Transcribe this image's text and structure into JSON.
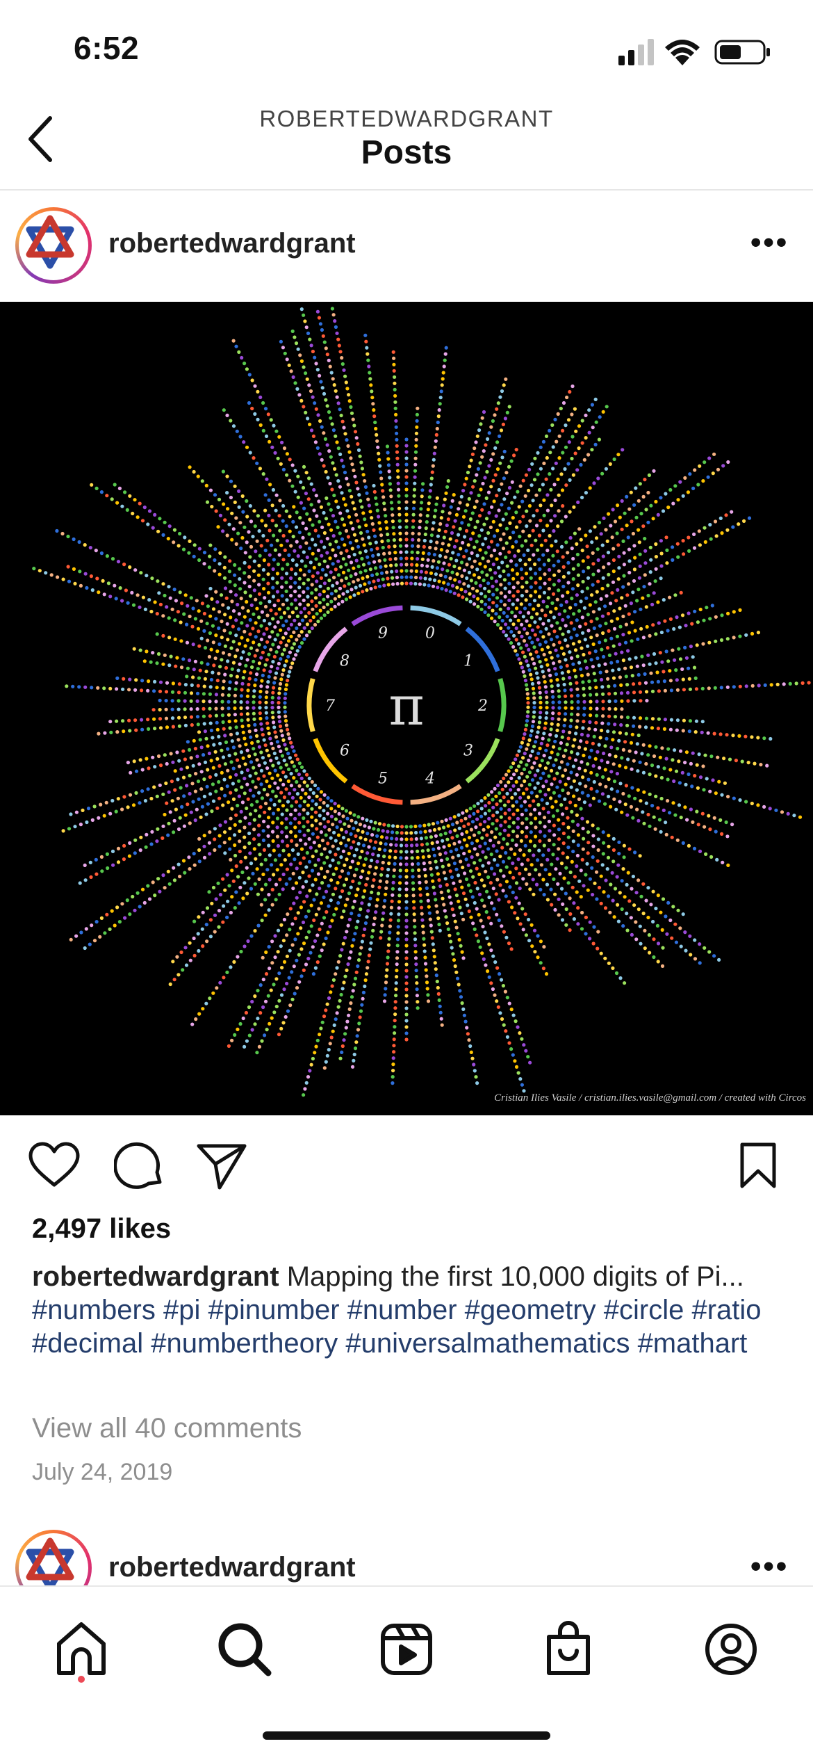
{
  "status_bar": {
    "time": "6:52"
  },
  "header": {
    "username": "ROBERTEDWARDGRANT",
    "title": "Posts"
  },
  "post": {
    "username": "robertedwardgrant",
    "image": {
      "center_symbol": "π",
      "ring_labels": [
        "0",
        "1",
        "2",
        "3",
        "4",
        "5",
        "6",
        "7",
        "8",
        "9"
      ],
      "credit": "Cristian Ilies Vasile / cristian.ilies.vasile@gmail.com / created with Circos"
    },
    "likes": "2,497 likes",
    "caption": {
      "user": "robertedwardgrant",
      "text": "Mapping the first 10,000 digits of Pi...",
      "hashtags": [
        "#numbers",
        "#pi",
        "#pinumber",
        "#number",
        "#geometry",
        "#circle",
        "#ratio",
        "#decimal",
        "#numbertheory",
        "#universalmathematics",
        "#mathart"
      ]
    },
    "view_comments": "View all 40 comments",
    "date": "July 24, 2019"
  },
  "next_post": {
    "username": "robertedwardgrant"
  },
  "colors": {
    "hashtag": "#243d6b",
    "muted": "#8e8e8e",
    "notification_dot": "#ed4956",
    "digit_colors": [
      "#8ecae6",
      "#2f6fdb",
      "#57c84d",
      "#9be15d",
      "#f4b183",
      "#ff5a36",
      "#ffc400",
      "#ffd84a",
      "#e7a6e8",
      "#9a4ad8"
    ]
  },
  "icons": {
    "back": "chevron-left-icon",
    "more": "more-horizontal-icon",
    "like": "heart-icon",
    "comment": "comment-icon",
    "share": "paper-plane-icon",
    "save": "bookmark-icon",
    "nav": [
      "home-icon",
      "search-icon",
      "reels-icon",
      "shop-icon",
      "profile-icon"
    ]
  }
}
